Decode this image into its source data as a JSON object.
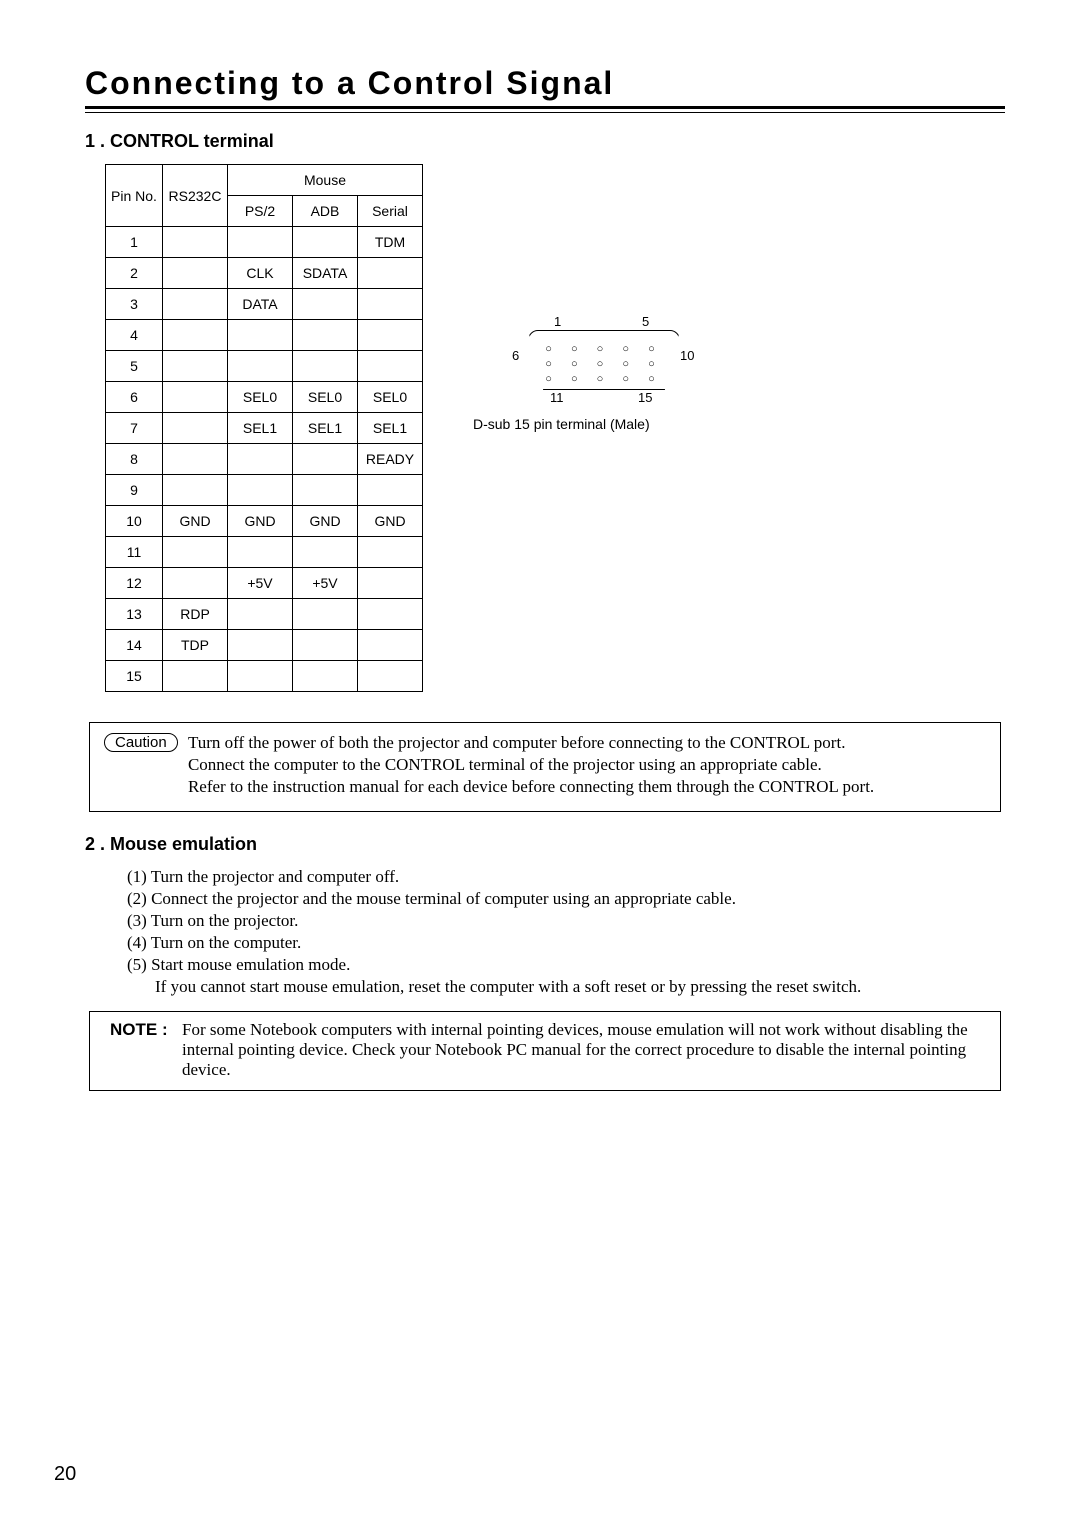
{
  "title": "Connecting  to  a  Control  Signal",
  "section1": "1 . CONTROL  terminal",
  "section2": "2 . Mouse  emulation",
  "table": {
    "h_pin": "Pin No.",
    "h_rs": "RS232C",
    "h_mouse": "Mouse",
    "h_ps2": "PS/2",
    "h_adb": "ADB",
    "h_serial": "Serial",
    "rows": [
      {
        "pin": "1",
        "rs": "",
        "ps2": "",
        "adb": "",
        "ser": "TDM"
      },
      {
        "pin": "2",
        "rs": "",
        "ps2": "CLK",
        "adb": "SDATA",
        "ser": ""
      },
      {
        "pin": "3",
        "rs": "",
        "ps2": "DATA",
        "adb": "",
        "ser": ""
      },
      {
        "pin": "4",
        "rs": "",
        "ps2": "",
        "adb": "",
        "ser": ""
      },
      {
        "pin": "5",
        "rs": "",
        "ps2": "",
        "adb": "",
        "ser": ""
      },
      {
        "pin": "6",
        "rs": "",
        "ps2": "SEL0",
        "adb": "SEL0",
        "ser": "SEL0"
      },
      {
        "pin": "7",
        "rs": "",
        "ps2": "SEL1",
        "adb": "SEL1",
        "ser": "SEL1"
      },
      {
        "pin": "8",
        "rs": "",
        "ps2": "",
        "adb": "",
        "ser": "READY"
      },
      {
        "pin": "9",
        "rs": "",
        "ps2": "",
        "adb": "",
        "ser": ""
      },
      {
        "pin": "10",
        "rs": "GND",
        "ps2": "GND",
        "adb": "GND",
        "ser": "GND"
      },
      {
        "pin": "11",
        "rs": "",
        "ps2": "",
        "adb": "",
        "ser": ""
      },
      {
        "pin": "12",
        "rs": "",
        "ps2": "+5V",
        "adb": "+5V",
        "ser": ""
      },
      {
        "pin": "13",
        "rs": "RDP",
        "ps2": "",
        "adb": "",
        "ser": ""
      },
      {
        "pin": "14",
        "rs": "TDP",
        "ps2": "",
        "adb": "",
        "ser": ""
      },
      {
        "pin": "15",
        "rs": "",
        "ps2": "",
        "adb": "",
        "ser": ""
      }
    ]
  },
  "connector": {
    "n1": "1",
    "n5": "5",
    "n6": "6",
    "n10": "10",
    "n11": "11",
    "n15": "15",
    "caption": "D-sub 15 pin terminal (Male)"
  },
  "caution": {
    "label": "Caution",
    "l1": "Turn off the power of both the projector and computer before connecting to the CONTROL port.",
    "l2": "Connect the computer to the CONTROL terminal of the projector using an appropriate cable.",
    "l3": "Refer to the instruction manual for each device before connecting them through the CONTROL port."
  },
  "mouse": {
    "i1": "(1) Turn the projector and computer off.",
    "i2": "(2) Connect the projector and the mouse terminal of computer using an appropriate cable.",
    "i3": "(3) Turn on the projector.",
    "i4": "(4) Turn on the computer.",
    "i5": "(5) Start mouse emulation mode.",
    "i5b": "If you cannot start mouse emulation, reset the computer with a soft reset or by pressing the reset switch."
  },
  "note": {
    "label": "NOTE :",
    "text": "For some Notebook computers with internal pointing devices, mouse emulation will not work without disabling the internal pointing device. Check your Notebook PC manual for the correct procedure to disable the internal pointing device."
  },
  "page_number": "20"
}
